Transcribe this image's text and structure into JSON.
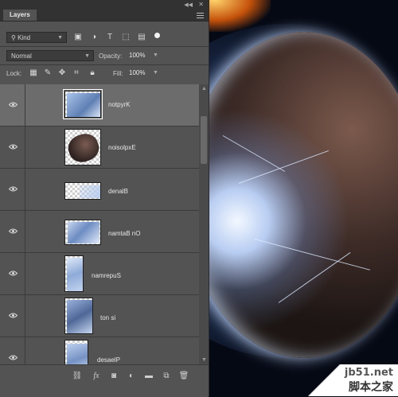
{
  "panel": {
    "tab_label": "Layers",
    "filter": {
      "kind_label": "Kind"
    },
    "blend": {
      "mode": "Normal",
      "opacity_label": "Opacity:",
      "opacity_value": "100%"
    },
    "lock": {
      "label": "Lock:",
      "fill_label": "Fill:",
      "fill_value": "100%"
    }
  },
  "layers": [
    {
      "name": "notpyrK",
      "selected": true
    },
    {
      "name": "noisolpxE",
      "selected": false
    },
    {
      "name": "denalB",
      "selected": false
    },
    {
      "name": "namtaB nO",
      "selected": false
    },
    {
      "name": "namrepuS",
      "selected": false
    },
    {
      "name": "ton si",
      "selected": false
    },
    {
      "name": "desaelP",
      "selected": false
    }
  ],
  "footer_icons": [
    "link-icon",
    "fx-icon",
    "mask-icon",
    "adjustment-icon",
    "group-icon",
    "new-layer-icon",
    "trash-icon"
  ],
  "watermark": {
    "site": "jb51.net",
    "brand": "脚本之家"
  }
}
